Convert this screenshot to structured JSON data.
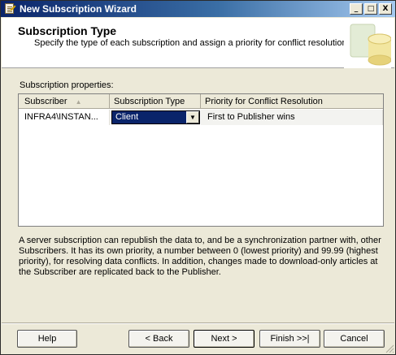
{
  "window": {
    "title": "New Subscription Wizard",
    "controls": {
      "minimize": "_",
      "maximize": "□",
      "close": "X"
    }
  },
  "header": {
    "title": "Subscription Type",
    "subtitle": "Specify the type of each subscription and assign a priority for conflict resolution."
  },
  "properties_label": "Subscription properties:",
  "grid": {
    "columns": [
      "Subscriber",
      "Subscription Type",
      "Priority for Conflict Resolution"
    ],
    "sort_indicator": "▲",
    "rows": [
      {
        "subscriber": "INFRA4\\INSTAN...",
        "type": "Client",
        "priority": "First to Publisher wins"
      }
    ]
  },
  "description": "A server subscription can republish the data to, and be a synchronization partner with, other Subscribers. It has its own priority, a number between 0 (lowest priority) and 99.99 (highest priority), for resolving data conflicts. In addition, changes made to download-only articles at the Subscriber are replicated back to the Publisher.",
  "buttons": {
    "help": "Help",
    "back": "< Back",
    "next": "Next >",
    "finish": "Finish >>|",
    "cancel": "Cancel"
  },
  "icons": {
    "app": "wizard-icon",
    "header_art": "database-cylinder-icon",
    "dropdown": "chevron-down-icon"
  }
}
